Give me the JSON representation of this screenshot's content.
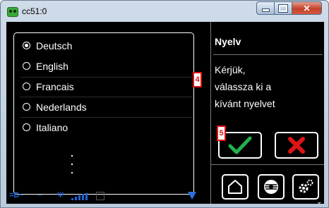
{
  "window": {
    "title": "cc51:0"
  },
  "languages": [
    {
      "label": "Deutsch",
      "selected": true
    },
    {
      "label": "English",
      "selected": false
    },
    {
      "label": "Francais",
      "selected": false
    },
    {
      "label": "Nederlands",
      "selected": false
    },
    {
      "label": "Italiano",
      "selected": false
    }
  ],
  "markers": {
    "m4": "4",
    "m5": "5"
  },
  "right": {
    "title": "Nyelv",
    "message_lines": [
      "Kérjük,",
      "válassza ki a",
      "kívánt nyelvet"
    ]
  },
  "colors": {
    "ok": "#22b14c",
    "cancel": "#e01414",
    "status": "#1e64d8"
  },
  "icons": [
    "home-icon",
    "symbol-icon",
    "settings-gear-icon"
  ]
}
